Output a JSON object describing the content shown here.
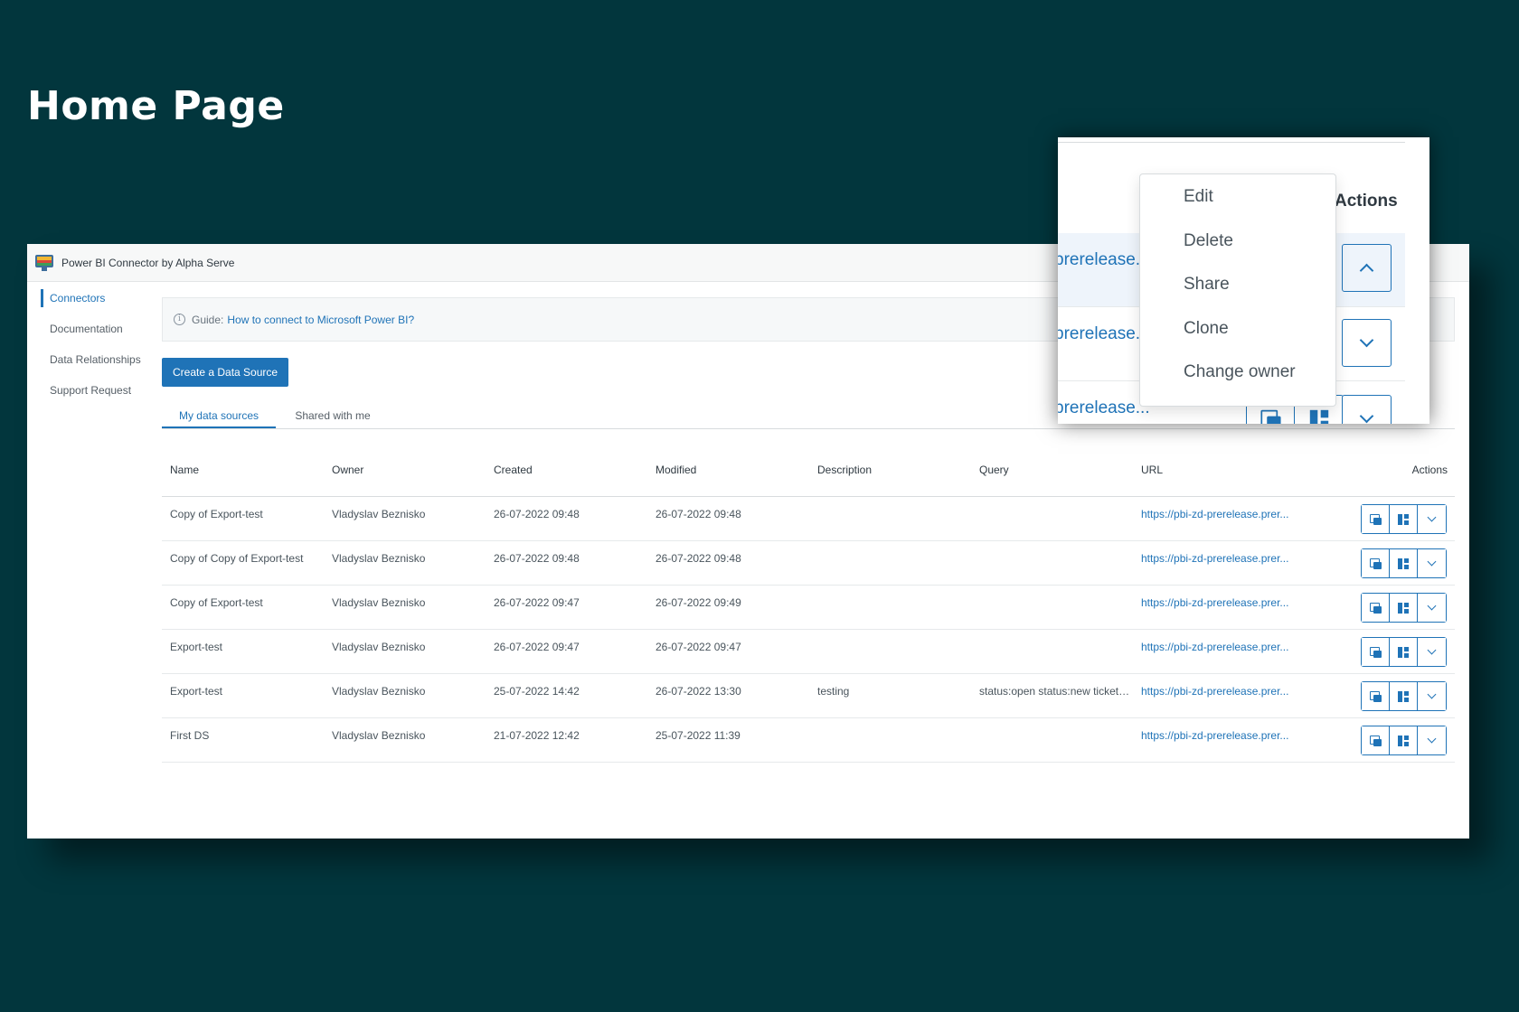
{
  "hero": {
    "title": "Home Page"
  },
  "app": {
    "name": "Power BI Connector by Alpha Serve",
    "sidebar": [
      {
        "label": "Connectors",
        "active": true
      },
      {
        "label": "Documentation",
        "active": false
      },
      {
        "label": "Data Relationships",
        "active": false
      },
      {
        "label": "Support Request",
        "active": false
      }
    ],
    "guide": {
      "prefix": "Guide:",
      "link": "How to connect to Microsoft Power BI?"
    },
    "create_button": "Create a Data Source",
    "tabs": [
      {
        "label": "My data sources",
        "active": true
      },
      {
        "label": "Shared with me",
        "active": false
      }
    ],
    "table": {
      "headers": [
        "Name",
        "Owner",
        "Created",
        "Modified",
        "Description",
        "Query",
        "URL",
        "Actions"
      ],
      "rows": [
        {
          "name": "Copy of Export-test",
          "owner": "Vladyslav Beznisko",
          "created": "26-07-2022 09:48",
          "modified": "26-07-2022 09:48",
          "description": "",
          "query": "",
          "url": "https://pbi-zd-prerelease.prer..."
        },
        {
          "name": "Copy of Copy of Export-test",
          "owner": "Vladyslav Beznisko",
          "created": "26-07-2022 09:48",
          "modified": "26-07-2022 09:48",
          "description": "",
          "query": "",
          "url": "https://pbi-zd-prerelease.prer..."
        },
        {
          "name": "Copy of Export-test",
          "owner": "Vladyslav Beznisko",
          "created": "26-07-2022 09:47",
          "modified": "26-07-2022 09:49",
          "description": "",
          "query": "",
          "url": "https://pbi-zd-prerelease.prer..."
        },
        {
          "name": "Export-test",
          "owner": "Vladyslav Beznisko",
          "created": "26-07-2022 09:47",
          "modified": "26-07-2022 09:47",
          "description": "",
          "query": "",
          "url": "https://pbi-zd-prerelease.prer..."
        },
        {
          "name": "Export-test",
          "owner": "Vladyslav Beznisko",
          "created": "25-07-2022 14:42",
          "modified": "26-07-2022 13:30",
          "description": "testing",
          "query": "status:open status:new ticket_t...",
          "url": "https://pbi-zd-prerelease.prer..."
        },
        {
          "name": "First DS",
          "owner": "Vladyslav Beznisko",
          "created": "21-07-2022 12:42",
          "modified": "25-07-2022 11:39",
          "description": "",
          "query": "",
          "url": "https://pbi-zd-prerelease.prer..."
        }
      ]
    },
    "row_actions_icons": [
      "copy-icon",
      "dashboard-icon",
      "chevron-down-icon"
    ]
  },
  "zoom_inset": {
    "actions_header": "Actions",
    "urls": [
      "prerelease..",
      "prerelease..",
      "prerelease..."
    ],
    "menu": [
      "Edit",
      "Delete",
      "Share",
      "Clone",
      "Change owner"
    ]
  },
  "colors": {
    "background": "#02363d",
    "accent": "#1f73b7"
  }
}
